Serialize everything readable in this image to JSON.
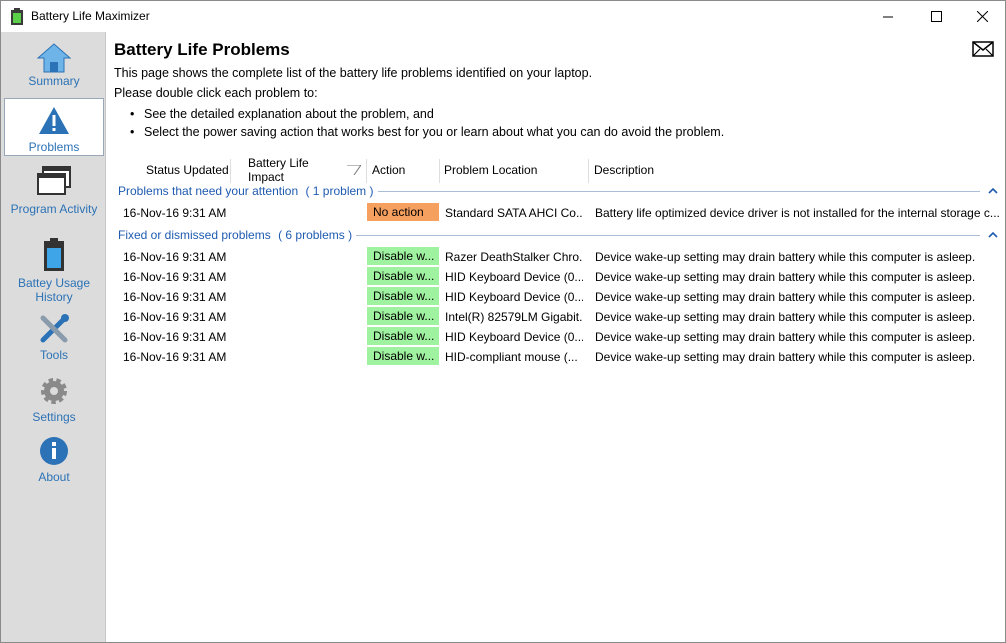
{
  "window": {
    "title": "Battery Life Maximizer"
  },
  "sidebar": {
    "items": [
      {
        "label": "Summary"
      },
      {
        "label": "Problems"
      },
      {
        "label": "Program Activity"
      },
      {
        "label": "Battey Usage History"
      },
      {
        "label": "Tools"
      },
      {
        "label": "Settings"
      },
      {
        "label": "About"
      }
    ]
  },
  "main": {
    "title": "Battery Life Problems",
    "intro1": "This page shows the complete list of the battery life problems identified on your laptop.",
    "intro2": "Please double click each problem to:",
    "bullets": [
      "See the detailed explanation about the problem, and",
      "Select the power saving action that works best for you or learn about what you can do avoid the problem."
    ]
  },
  "table": {
    "columns": [
      "Status Updated",
      "Battery Life Impact",
      "Action",
      "Problem Location",
      "Description"
    ],
    "groups": [
      {
        "label": "Problems that need your attention",
        "count": "( 1 problem )",
        "rows": [
          {
            "status": "16-Nov-16 9:31 AM",
            "action": "No action",
            "location": "Standard SATA AHCI Co...",
            "description": "Battery life optimized device driver is not installed for the internal storage c..."
          }
        ]
      },
      {
        "label": "Fixed or dismissed problems",
        "count": "( 6 problems )",
        "rows": [
          {
            "status": "16-Nov-16 9:31 AM",
            "action": "Disable w...",
            "location": "Razer DeathStalker Chro...",
            "description": "Device wake-up setting may drain battery while this computer is asleep."
          },
          {
            "status": "16-Nov-16 9:31 AM",
            "action": "Disable w...",
            "location": "HID Keyboard Device (0...",
            "description": "Device wake-up setting may drain battery while this computer is asleep."
          },
          {
            "status": "16-Nov-16 9:31 AM",
            "action": "Disable w...",
            "location": "HID Keyboard Device (0...",
            "description": "Device wake-up setting may drain battery while this computer is asleep."
          },
          {
            "status": "16-Nov-16 9:31 AM",
            "action": "Disable w...",
            "location": "Intel(R) 82579LM Gigabit...",
            "description": "Device wake-up setting may drain battery while this computer is asleep."
          },
          {
            "status": "16-Nov-16 9:31 AM",
            "action": "Disable w...",
            "location": "HID Keyboard Device (0...",
            "description": "Device wake-up setting may drain battery while this computer is asleep."
          },
          {
            "status": "16-Nov-16 9:31 AM",
            "action": "Disable w...",
            "location": "HID-compliant mouse (...",
            "description": "Device wake-up setting may drain battery while this computer is asleep."
          }
        ]
      }
    ]
  },
  "colors": {
    "accent": "#2b72b6",
    "no_action": "#f6a05f",
    "disable": "#9ff29f",
    "sidebar": "#dcdcdc"
  }
}
